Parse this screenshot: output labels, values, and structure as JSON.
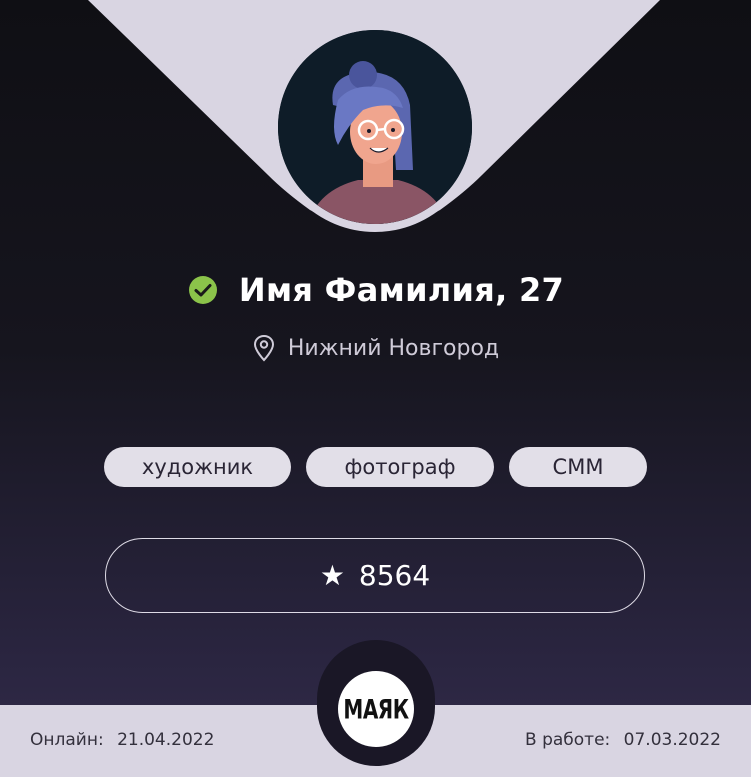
{
  "profile": {
    "name": "Имя Фамилия, 27",
    "city": "Нижний Новгород",
    "verified": true
  },
  "tags": [
    "художник",
    "фотограф",
    "СММ"
  ],
  "rating": {
    "value": "8564",
    "icon": "star-icon"
  },
  "footer": {
    "online_label": "Онлайн:",
    "online_date": "21.04.2022",
    "work_label": "В работе:",
    "work_date": "07.03.2022",
    "logo_text": "МАЯК"
  },
  "colors": {
    "wedge": "#d9d5e2",
    "verified_green": "#8bc34a",
    "tag_bg": "#e2dfe8"
  }
}
